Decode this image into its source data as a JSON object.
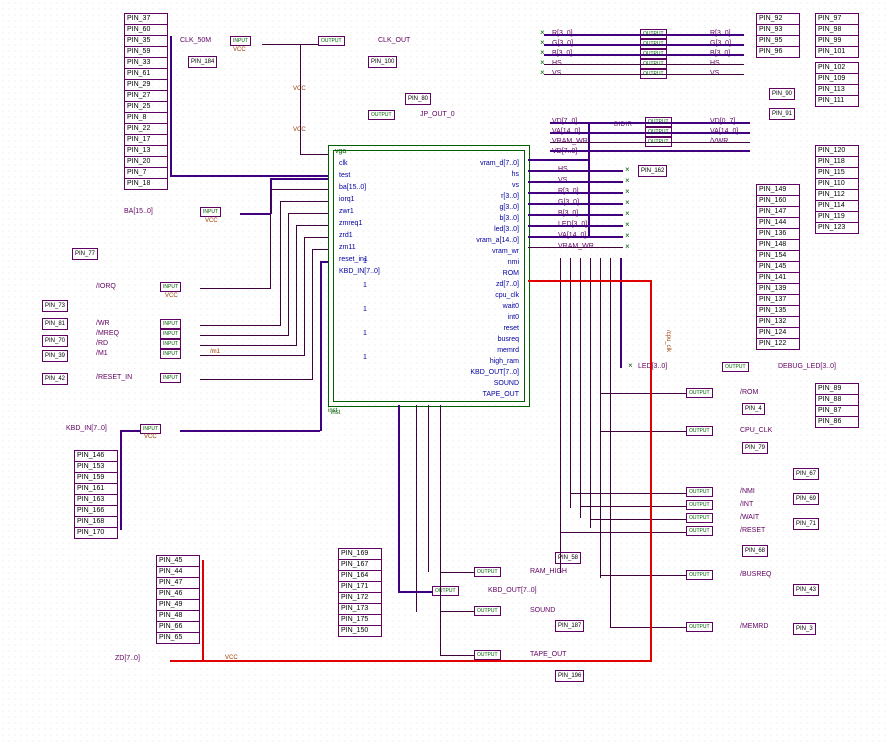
{
  "diagram_type": "FPGA schematic block diagram",
  "chip": {
    "title": "vga",
    "instance": "inst",
    "left_ports": [
      "clk",
      "test",
      "ba[15..0]",
      "iorq1",
      "zwr1",
      "zmreq1",
      "zrd1",
      "zm11",
      "reset_in1",
      "KBD_IN[7..0]"
    ],
    "right_ports": [
      "vram_d[7..0]",
      "hs",
      "vs",
      "r[3..0]",
      "g[3..0]",
      "b[3..0]",
      "led[3..0]",
      "vram_a[14..0]",
      "vram_wr",
      "nmi",
      "ROM",
      "zd[7..0]",
      "cpu_clk",
      "wait0",
      "int0",
      "reset",
      "busreq",
      "memrd",
      "high_ram",
      "KBD_OUT[7..0]",
      "SOUND",
      "TAPE_OUT"
    ]
  },
  "pin_groups": {
    "top_left": [
      "PIN_37",
      "PIN_60",
      "PIN_35",
      "PIN_59",
      "PIN_33",
      "PIN_61",
      "PIN_29",
      "PIN_27",
      "PIN_25",
      "PIN_8",
      "PIN_22",
      "PIN_17",
      "PIN_13",
      "PIN_20",
      "PIN_7",
      "PIN_18"
    ],
    "clk_pin": "PIN_184",
    "iorq_pin": "PIN_77",
    "left_stack_labels": [
      "/IORQ",
      "/WR",
      "/MREQ",
      "/RD",
      "/M1",
      "/RESET_IN"
    ],
    "left_stack_pins": [
      "PIN_73",
      "PIN_81",
      "PIN_70",
      "PIN_39",
      "PIN_42"
    ],
    "kbd_group": [
      "PIN_146",
      "PIN_153",
      "PIN_159",
      "PIN_161",
      "PIN_163",
      "PIN_166",
      "PIN_168",
      "PIN_170"
    ],
    "zd_group": [
      "PIN_45",
      "PIN_44",
      "PIN_47",
      "PIN_46",
      "PIN_49",
      "PIN_48",
      "PIN_66",
      "PIN_65"
    ],
    "mid_pin_list": [
      "PIN_169",
      "PIN_167",
      "PIN_164",
      "PIN_171",
      "PIN_172",
      "PIN_173",
      "PIN_175",
      "PIN_150"
    ],
    "top_right_a": [
      "PIN_92",
      "PIN_93",
      "PIN_95",
      "PIN_96"
    ],
    "top_right_b": [
      "PIN_97",
      "PIN_98",
      "PIN_99",
      "PIN_101"
    ],
    "right_group_c": [
      "PIN_102",
      "PIN_109",
      "PIN_113",
      "PIN_111"
    ],
    "pin_90": "PIN_90",
    "pin_91": "PIN_91",
    "pin_162": "PIN_162",
    "right_group_d": [
      "PIN_120",
      "PIN_118",
      "PIN_115",
      "PIN_110",
      "PIN_112",
      "PIN_114",
      "PIN_119",
      "PIN_123"
    ],
    "right_group_e": [
      "PIN_149",
      "PIN_160",
      "PIN_147",
      "PIN_144",
      "PIN_136",
      "PIN_148",
      "PIN_154",
      "PIN_145",
      "PIN_141",
      "PIN_139",
      "PIN_137",
      "PIN_135",
      "PIN_132",
      "PIN_124",
      "PIN_122"
    ],
    "rom_group": [
      "PIN_89",
      "PIN_88",
      "PIN_87",
      "PIN_86"
    ],
    "pin_4": "PIN_4",
    "pin_79": "PIN_79",
    "pin_67": "PIN_67",
    "pin_69": "PIN_69",
    "pin_71": "PIN_71",
    "pin_68": "PIN_68",
    "pin_43": "PIN_43",
    "pin_3": "PIN_3",
    "pin_58": "PIN_58",
    "pin_187": "PIN_187",
    "pin_196": "PIN_196",
    "pin_100": "PIN_100",
    "pin_80": "PIN_80"
  },
  "net_labels": {
    "clk_in": "CLK_50M",
    "clk_out": "CLK_OUT",
    "ba": "BA[15..0]",
    "kbd_in": "KBD_IN[7..0]",
    "zd": "ZD[7..0]",
    "rgb": [
      "R[3..0]",
      "G[3..0]",
      "B[3..0]",
      "HS",
      "VS"
    ],
    "rgb_out": [
      "R[3..0]",
      "G[3..0]",
      "B[3..0]",
      "HS",
      "VS"
    ],
    "vd_group": [
      "VD[7..0]",
      "VA[14..0]",
      "VRAM_WR",
      "VD[7..0]"
    ],
    "vd_out": [
      "VD[0..7]",
      "VA[14..0]",
      "/VWR"
    ],
    "chip_right_nets": [
      "HS",
      "VS",
      "R[3..0]",
      "G[3..0]",
      "B[3..0]",
      "LED[3..0]",
      "VA[14..0]",
      "VRAM_WR"
    ],
    "jp_out": "JP_OUT_0",
    "debug_led": "DEBUG_LED[3..0]",
    "rom": "/ROM",
    "cpu_clk": "CPU_CLK",
    "nmi": "/NMI",
    "int": "/INT",
    "wait": "/WAIT",
    "reset": "/RESET",
    "busreq": "/BUSREQ",
    "memrd": "/MEMRD",
    "ram_high": "RAM_HIGH",
    "kbd_out": "KBD_OUT[7..0]",
    "sound": "SOUND",
    "tape_out": "TAPE_OUT",
    "bidir": "BIDIR",
    "led_sig": "LED[3..0]"
  },
  "dir_labels": {
    "input": "INPUT",
    "output": "OUTPUT",
    "vcc": "VCC",
    "m1": "/m1",
    "cpu_clk_side": "/cpu_clk"
  }
}
